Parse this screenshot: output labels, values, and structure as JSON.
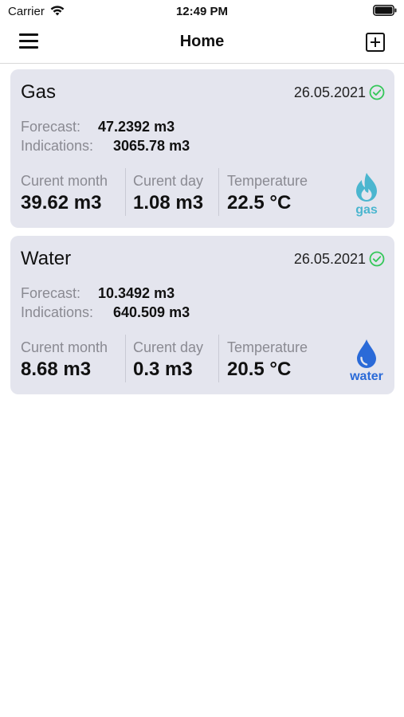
{
  "status_bar": {
    "carrier": "Carrier",
    "time": "12:49 PM"
  },
  "nav": {
    "title": "Home",
    "menu_icon": "hamburger-menu-icon",
    "add_icon": "add-square-icon"
  },
  "cards": [
    {
      "name": "Gas",
      "date": "26.05.2021",
      "status_icon": "check-circle-icon",
      "forecast_label": "Forecast:",
      "forecast_value": "47.2392 m3",
      "indications_label": "Indications:",
      "indications_value": "3065.78 m3",
      "current_month_label": "Curent month",
      "current_month_value": "39.62 m3",
      "current_day_label": "Curent day",
      "current_day_value": "1.08 m3",
      "temperature_label": "Temperature",
      "temperature_value": "22.5 °C",
      "type_icon": "gas-flame-icon",
      "type_label": "gas",
      "accent_color": "#4bb6cf"
    },
    {
      "name": "Water",
      "date": "26.05.2021",
      "status_icon": "check-circle-icon",
      "forecast_label": "Forecast:",
      "forecast_value": "10.3492 m3",
      "indications_label": "Indications:",
      "indications_value": "640.509 m3",
      "current_month_label": "Curent month",
      "current_month_value": "8.68 m3",
      "current_day_label": "Curent day",
      "current_day_value": "0.3 m3",
      "temperature_label": "Temperature",
      "temperature_value": "20.5 °C",
      "type_icon": "water-drop-icon",
      "type_label": "water",
      "accent_color": "#2a6ad8"
    }
  ],
  "colors": {
    "card_background": "#e4e5ee",
    "check_green": "#34c759"
  }
}
